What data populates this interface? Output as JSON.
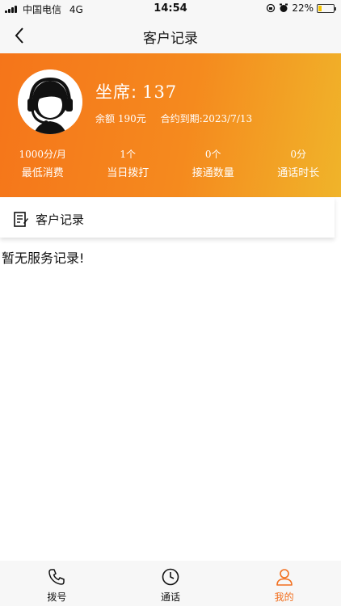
{
  "status_bar": {
    "carrier": "中国电信",
    "network": "4G",
    "time": "14:54",
    "battery_percent": "22%",
    "battery_level": 0.22
  },
  "nav": {
    "title": "客户记录",
    "back_icon": "chevron-left-icon"
  },
  "profile": {
    "agent_label": "坐席:",
    "agent_number": "137",
    "balance": "余额 190元",
    "contract_expiry": "合约到期:2023/7/13",
    "avatar_icon": "headset-agent-icon",
    "stats": [
      {
        "value": "1000分/月",
        "label": "最低消费"
      },
      {
        "value": "1个",
        "label": "当日拨打"
      },
      {
        "value": "0个",
        "label": "接通数量"
      },
      {
        "value": "0分",
        "label": "通话时长"
      }
    ]
  },
  "section": {
    "title": "客户记录",
    "icon": "notebook-icon"
  },
  "empty_message": "暂无服务记录!",
  "tabs": [
    {
      "label": "拨号",
      "icon": "phone-icon",
      "active": false
    },
    {
      "label": "通话",
      "icon": "clock-icon",
      "active": false
    },
    {
      "label": "我的",
      "icon": "user-icon",
      "active": true
    }
  ],
  "colors": {
    "accent": "#f26f1e",
    "header_gradient_start": "#f5751a",
    "header_gradient_end": "#f0b42a"
  }
}
